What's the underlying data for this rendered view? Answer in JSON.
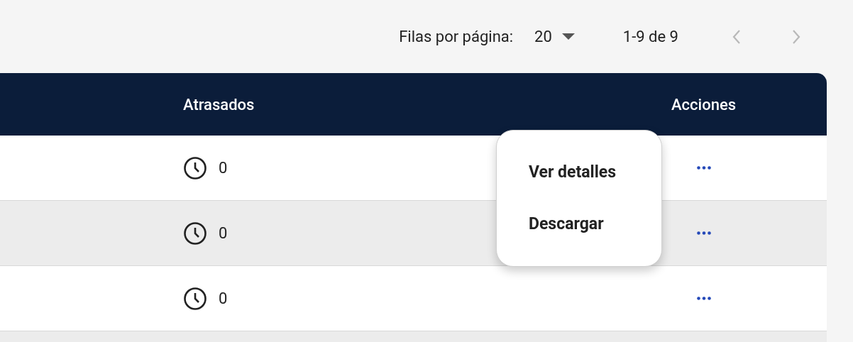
{
  "pagination": {
    "label": "Filas por página:",
    "rows_per_page": "20",
    "range": "1-9 de 9",
    "prev_disabled": true,
    "next_disabled": true
  },
  "table": {
    "columns": [
      {
        "label": "Atrasados"
      },
      {
        "label": "Acciones"
      }
    ],
    "rows": [
      {
        "overdue": "0"
      },
      {
        "overdue": "0"
      },
      {
        "overdue": "0"
      }
    ]
  },
  "menu": {
    "items": [
      {
        "label": "Ver detalles"
      },
      {
        "label": "Descargar"
      }
    ]
  }
}
